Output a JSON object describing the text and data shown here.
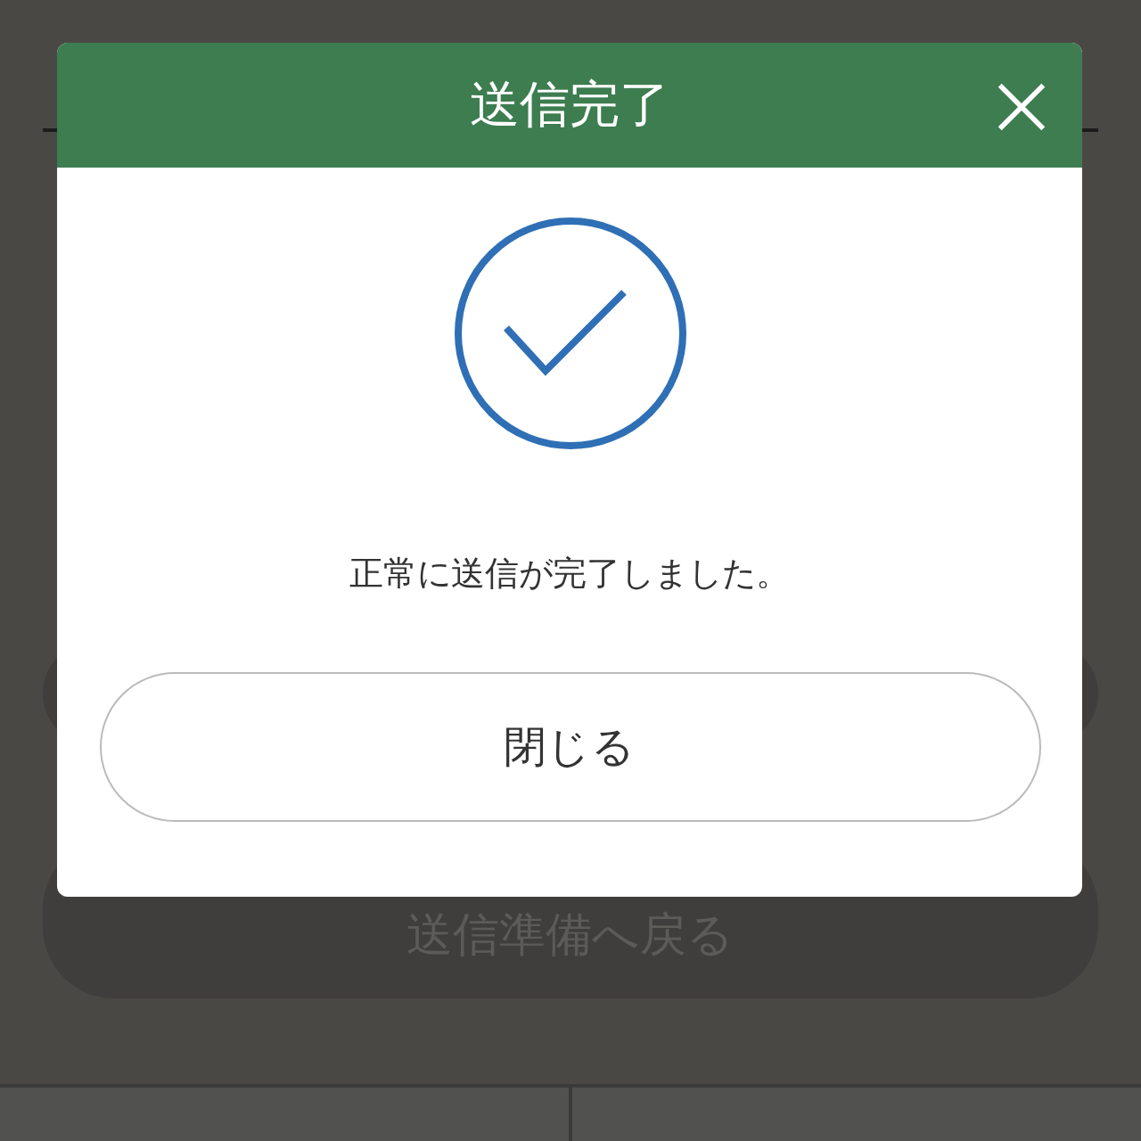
{
  "background_page": {
    "buttons": [
      {
        "kind": "blank"
      },
      {
        "kind": "labeled",
        "label": "送信準備へ戻る"
      }
    ]
  },
  "dialog": {
    "title": "送信完了",
    "message": "正常に送信が完了しました。",
    "close_button": "閉じる"
  }
}
